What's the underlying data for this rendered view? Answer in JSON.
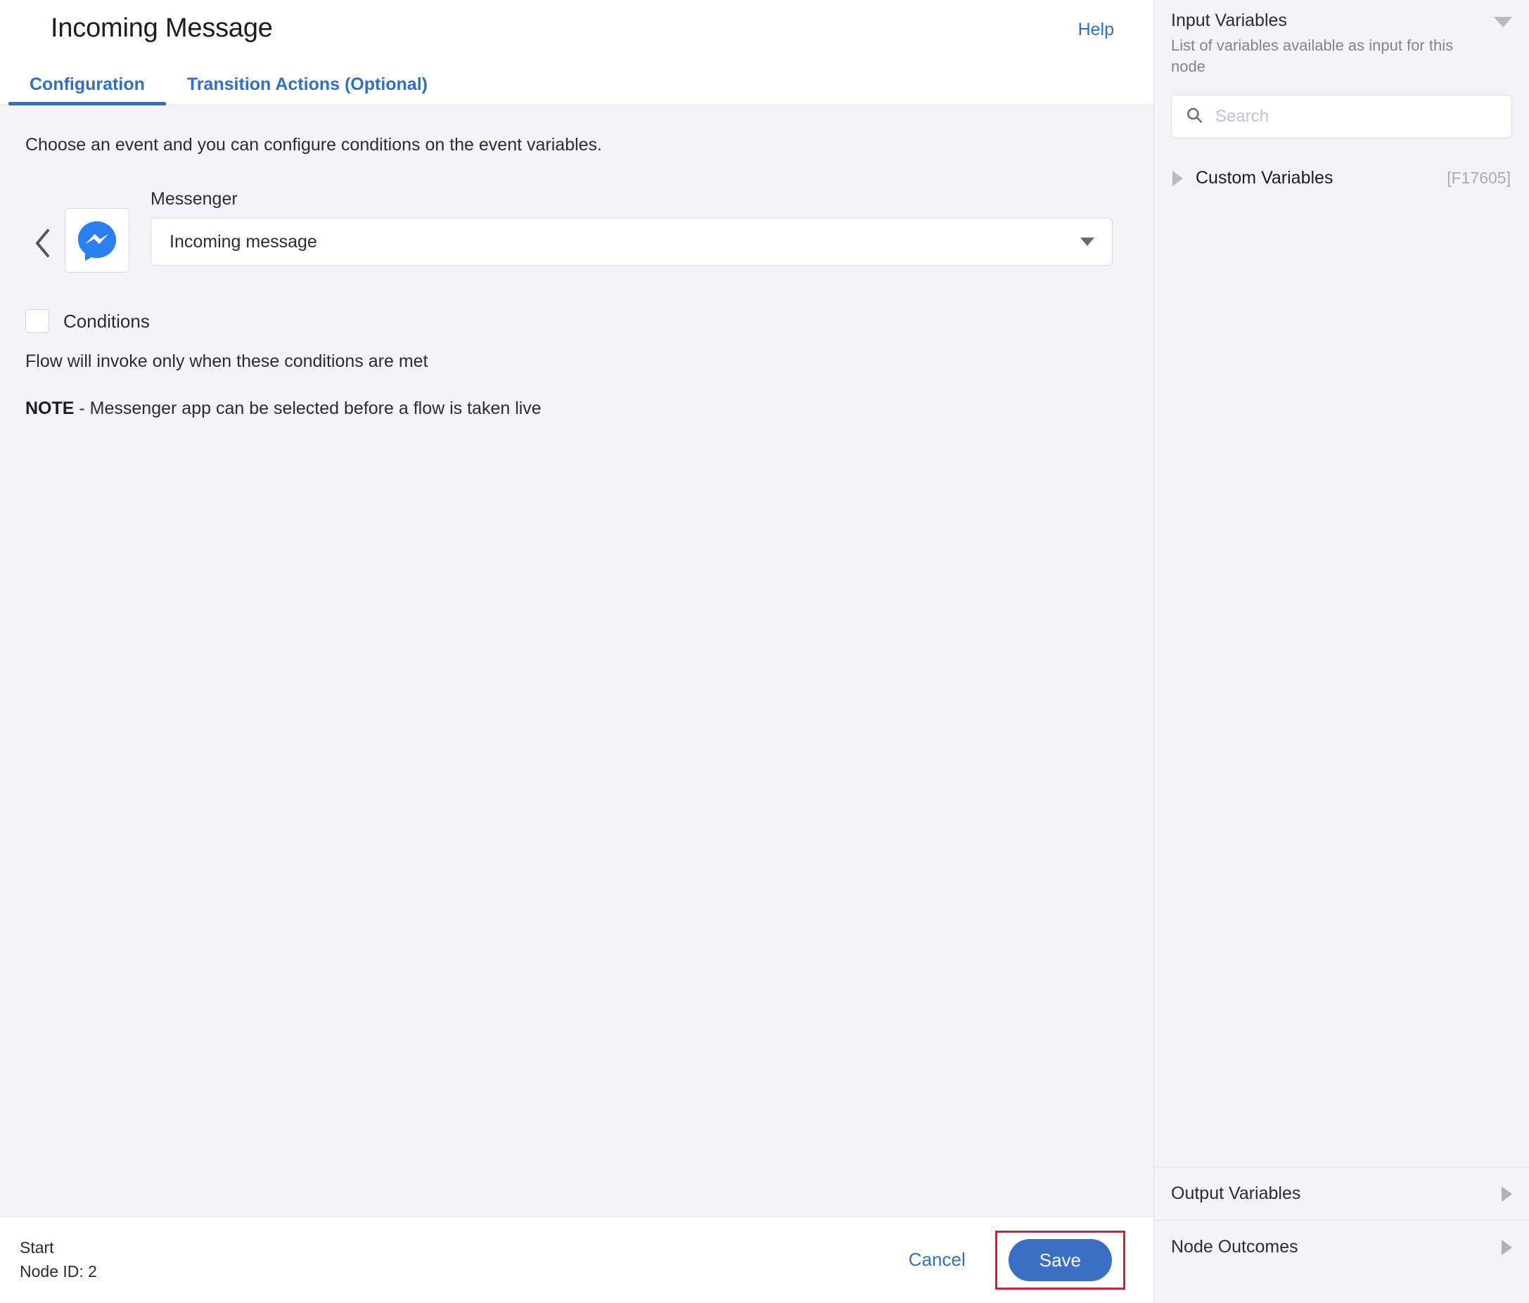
{
  "header": {
    "title": "Incoming Message",
    "help_label": "Help"
  },
  "tabs": [
    {
      "label": "Configuration",
      "active": true
    },
    {
      "label": "Transition Actions (Optional)",
      "active": false
    }
  ],
  "main": {
    "intro_text": "Choose an event and you can configure conditions on the event variables.",
    "app_icon": "messenger-icon",
    "event": {
      "label": "Messenger",
      "selected_value": "Incoming message",
      "caret_icon": "chevron-down-icon"
    },
    "back_icon": "chevron-left-icon",
    "conditions": {
      "label": "Conditions",
      "checked": false,
      "hint": "Flow will invoke only when these conditions are met"
    },
    "note": {
      "prefix": "NOTE",
      "body": " - Messenger app can be selected before a flow is taken live"
    }
  },
  "footer": {
    "node_type": "Start",
    "node_id": "Node ID: 2",
    "cancel_label": "Cancel",
    "save_label": "Save",
    "save_highlight_color": "#cc2233"
  },
  "right_panel": {
    "title": "Input Variables",
    "subtitle": "List of variables available as input for this node",
    "collapse_icon": "caret-down-icon",
    "search": {
      "placeholder": "Search",
      "value": "",
      "icon": "search-icon"
    },
    "variable_groups": [
      {
        "label": "Custom Variables",
        "id": "[F17605]",
        "expand_icon": "caret-right-icon"
      }
    ],
    "accordions": [
      {
        "label": "Output Variables",
        "caret_icon": "caret-right-icon"
      },
      {
        "label": "Node Outcomes",
        "caret_icon": "caret-right-icon"
      }
    ]
  },
  "colors": {
    "accent_blue": "#2e6fc7",
    "save_blue": "#3a6fc4",
    "panel_bg": "#f4f4f8",
    "highlight_red": "#cc2233"
  }
}
